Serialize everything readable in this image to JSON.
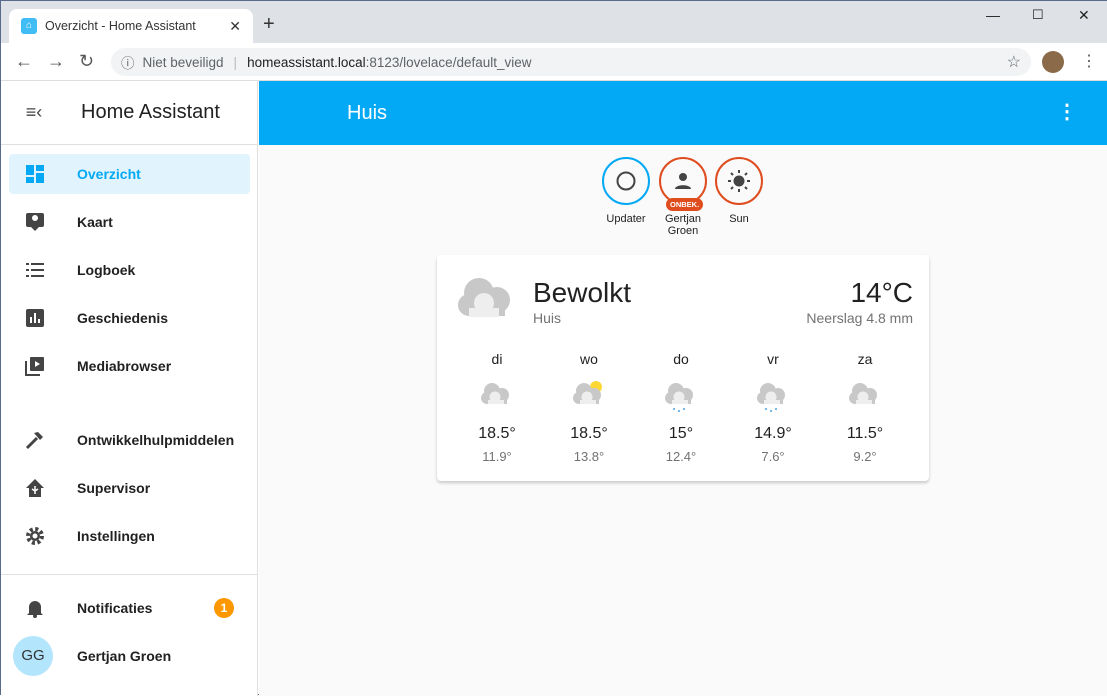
{
  "browser": {
    "tab_title": "Overzicht - Home Assistant",
    "security": "Niet beveiligd",
    "url_host": "homeassistant.local",
    "url_path": ":8123/lovelace/default_view"
  },
  "sidebar": {
    "title": "Home Assistant",
    "items": [
      {
        "label": "Overzicht"
      },
      {
        "label": "Kaart"
      },
      {
        "label": "Logboek"
      },
      {
        "label": "Geschiedenis"
      },
      {
        "label": "Mediabrowser"
      },
      {
        "label": "Ontwikkelhulpmiddelen"
      },
      {
        "label": "Supervisor"
      },
      {
        "label": "Instellingen"
      }
    ],
    "notifications": {
      "label": "Notificaties",
      "count": "1"
    },
    "user": {
      "initials": "GG",
      "name": "Gertjan Groen"
    }
  },
  "header": {
    "title": "Huis"
  },
  "badges": [
    {
      "name": "Updater"
    },
    {
      "name": "Gertjan Groen",
      "state": "ONBEK."
    },
    {
      "name": "Sun"
    }
  ],
  "weather": {
    "condition": "Bewolkt",
    "location": "Huis",
    "temperature": "14°C",
    "precipitation": "Neerslag 4.8 mm",
    "forecast": [
      {
        "day": "di",
        "high": "18.5°",
        "low": "11.9°",
        "icon": "cloudy"
      },
      {
        "day": "wo",
        "high": "18.5°",
        "low": "13.8°",
        "icon": "partly-cloudy"
      },
      {
        "day": "do",
        "high": "15°",
        "low": "12.4°",
        "icon": "rainy"
      },
      {
        "day": "vr",
        "high": "14.9°",
        "low": "7.6°",
        "icon": "rainy"
      },
      {
        "day": "za",
        "high": "11.5°",
        "low": "9.2°",
        "icon": "cloudy"
      }
    ]
  },
  "colors": {
    "primary": "#03a9f4",
    "badge_red": "#df4c1e",
    "notification": "#ff9800"
  }
}
